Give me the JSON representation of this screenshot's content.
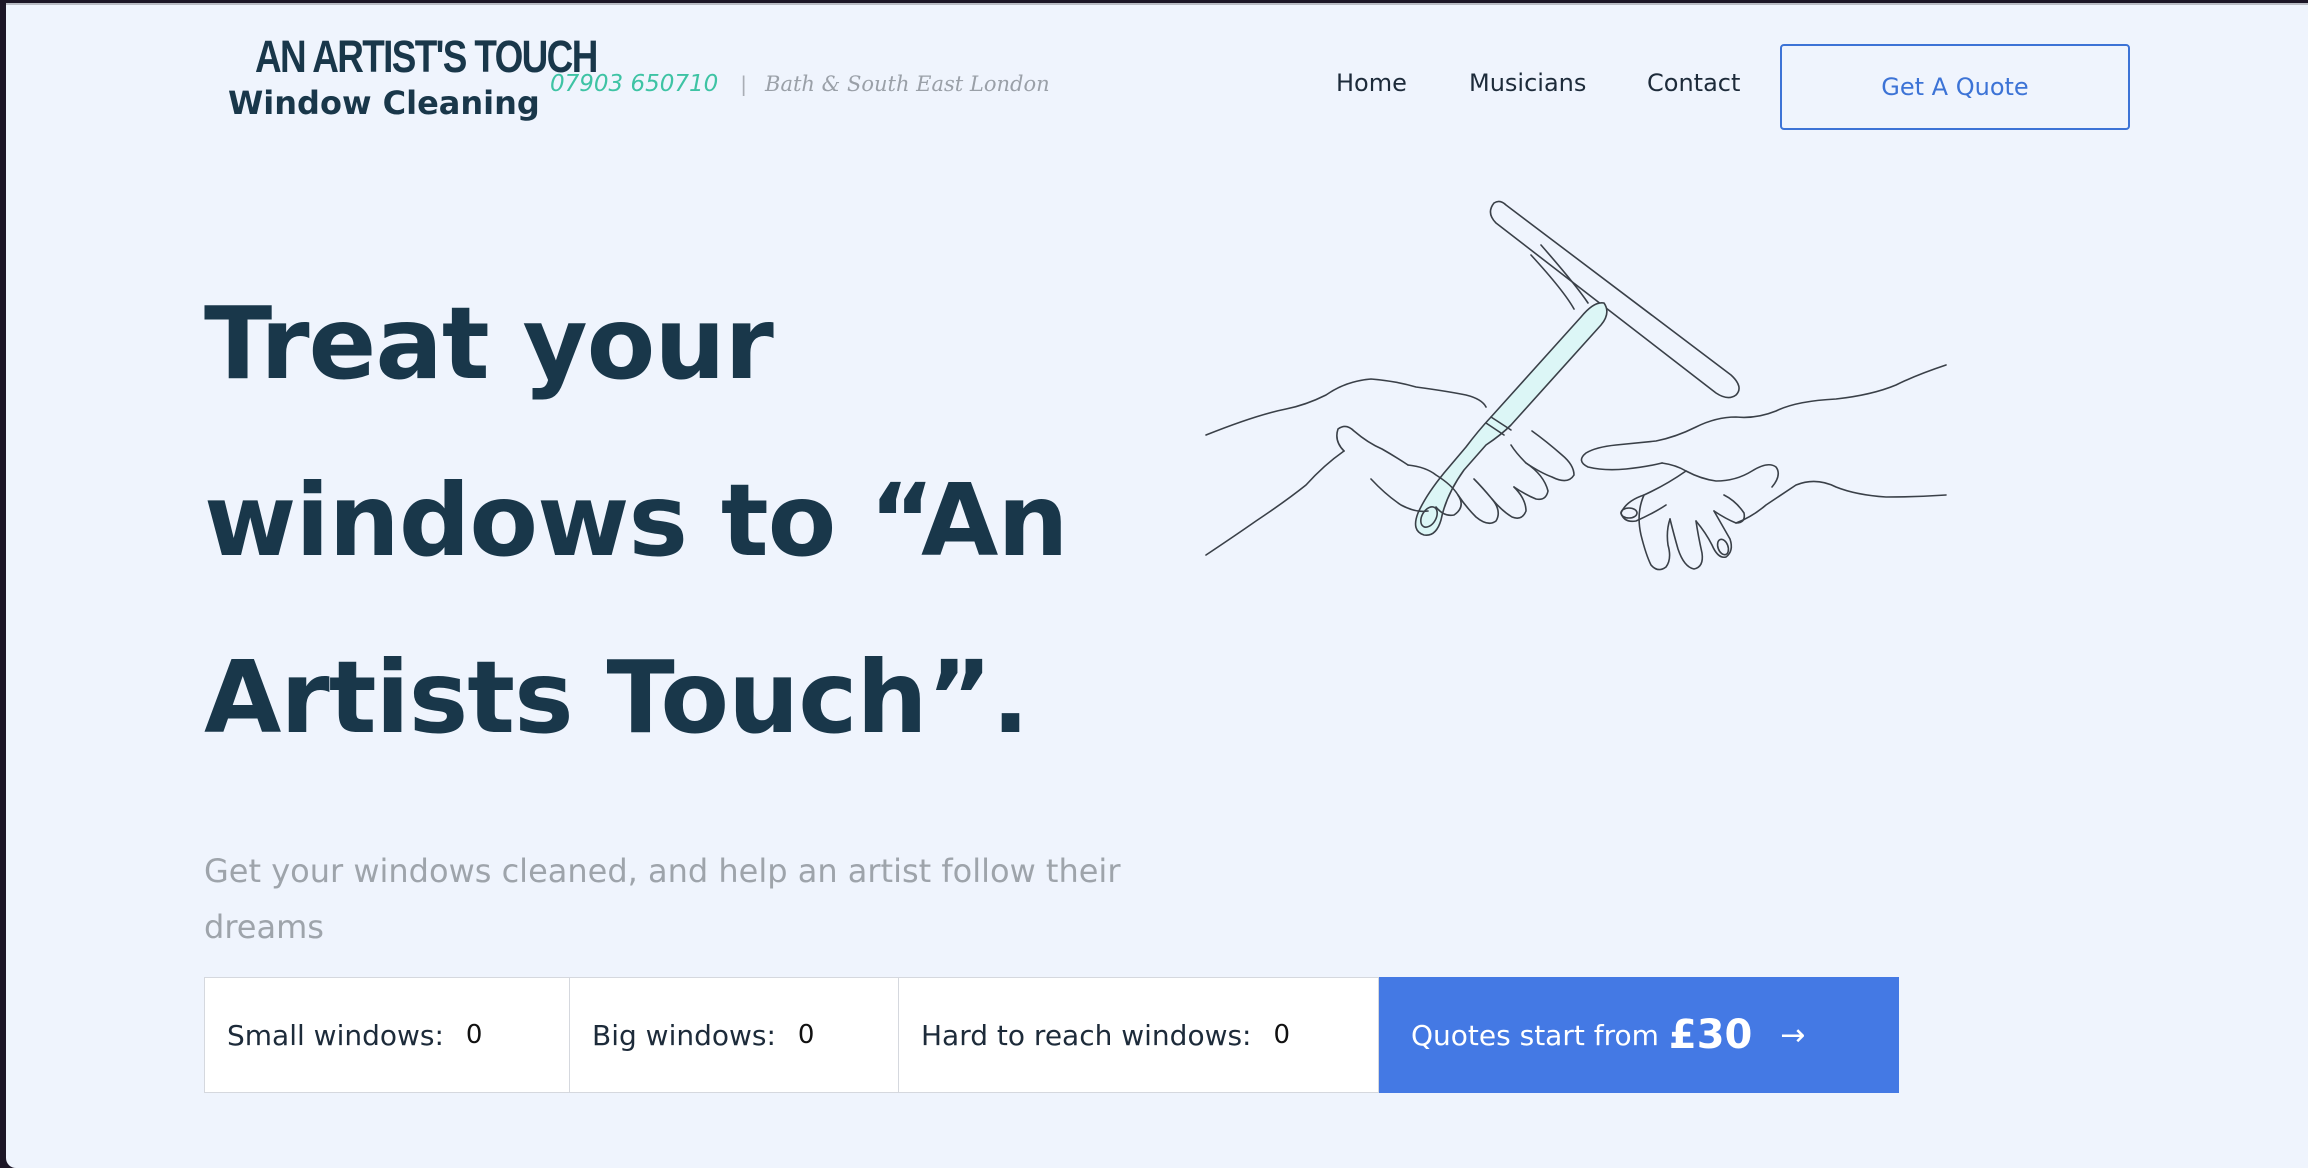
{
  "brand": {
    "title": "AN ARTIST'S TOUCH",
    "subtitle": "Window Cleaning",
    "phone": "07903 650710",
    "divider": "|",
    "location": "Bath & South East London"
  },
  "nav": {
    "items": [
      "Home",
      "Musicians",
      "Contact"
    ],
    "cta_label": "Get A Quote"
  },
  "hero": {
    "title_lines": [
      "Treat your",
      "windows to “An",
      "Artists Touch”."
    ],
    "subtitle": "Get your windows cleaned, and help an artist follow their dreams"
  },
  "calculator": {
    "fields": [
      {
        "label": "Small windows:",
        "value": "0"
      },
      {
        "label": "Big windows:",
        "value": "0"
      },
      {
        "label": "Hard to reach windows:",
        "value": "0"
      }
    ],
    "cta_prefix": "Quotes start from",
    "cta_price": "£30",
    "cta_arrow": "→"
  },
  "colors": {
    "background": "#eff4fd",
    "heading": "#19374a",
    "accent_blue": "#4479e4",
    "phone_green": "#3ec3a4",
    "muted": "#9ea4ab"
  },
  "icons": {
    "illustration": "hands-with-squeegee-illustration",
    "cta_arrow": "arrow-right-icon"
  }
}
